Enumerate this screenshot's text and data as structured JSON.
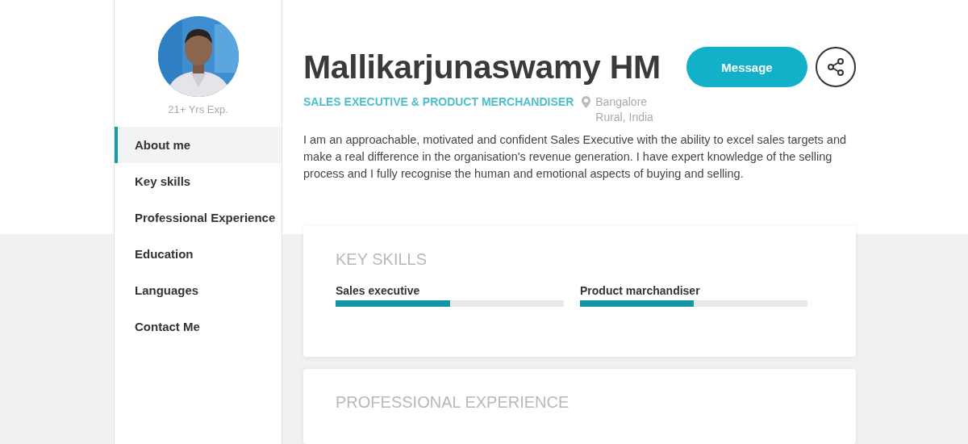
{
  "sidebar": {
    "experience": "21+ Yrs Exp.",
    "items": [
      {
        "label": "About me",
        "selected": true
      },
      {
        "label": "Key skills",
        "selected": false
      },
      {
        "label": "Professional Experience",
        "selected": false
      },
      {
        "label": "Education",
        "selected": false
      },
      {
        "label": "Languages",
        "selected": false
      },
      {
        "label": "Contact Me",
        "selected": false
      }
    ]
  },
  "profile": {
    "name": "Mallikarjunaswamy HM",
    "title": "SALES EXECUTIVE & PRODUCT MERCHANDISER",
    "location": "Bangalore Rural, India",
    "about": "I am an approachable, motivated and confident Sales Executive with the ability to excel sales targets and make a real difference in the organisation's revenue generation. I have expert knowledge of the selling process and I fully recognise the human and emotional aspects of buying and selling.",
    "buttons": [
      "Message"
    ]
  },
  "sections": [
    {
      "kind": "skills",
      "title": "KEY SKILLS",
      "skills": [
        {
          "name": "Sales executive",
          "level": 0.5
        },
        {
          "name": "Product marchandiser",
          "level": 0.5
        }
      ]
    },
    {
      "kind": "plain",
      "title": "PROFESSIONAL EXPERIENCE"
    }
  ]
}
